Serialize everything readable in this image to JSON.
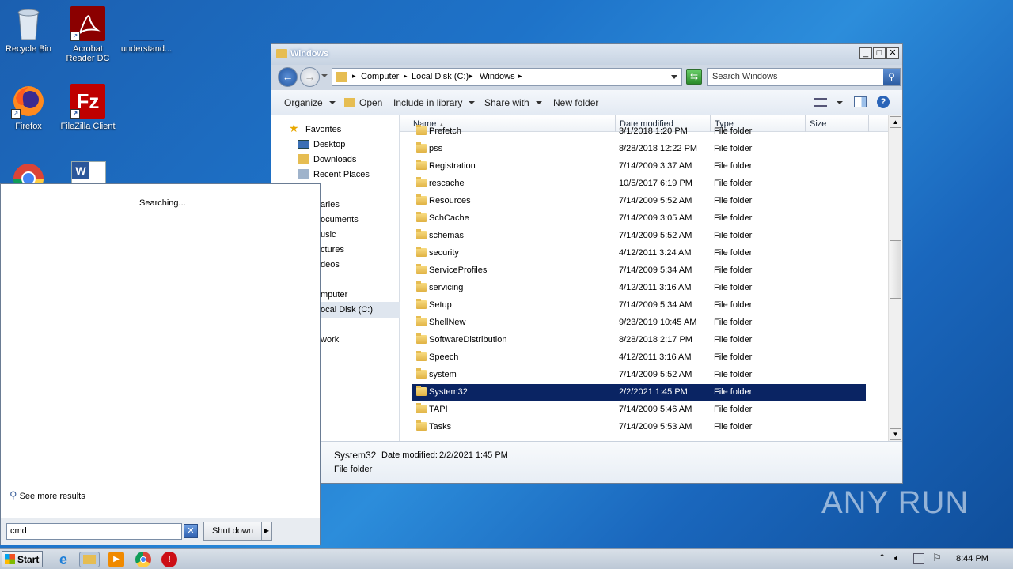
{
  "desktop": {
    "icons": [
      {
        "label": "Recycle Bin"
      },
      {
        "label": "Acrobat Reader DC"
      },
      {
        "label": "understand..."
      },
      {
        "label": "Firefox"
      },
      {
        "label": "FileZilla Client"
      }
    ]
  },
  "explorer": {
    "title": "Windows",
    "breadcrumb": [
      "Computer",
      "Local Disk (C:)",
      "Windows"
    ],
    "search_placeholder": "Search Windows",
    "toolbar": {
      "organize": "Organize",
      "open": "Open",
      "include": "Include in library",
      "share": "Share with",
      "new_folder": "New folder"
    },
    "nav": {
      "favorites": "Favorites",
      "desktop": "Desktop",
      "downloads": "Downloads",
      "recent": "Recent Places",
      "libraries": "aries",
      "documents": "ocuments",
      "music": "usic",
      "pictures": "ctures",
      "videos": "deos",
      "computer": "mputer",
      "local_disk": "ocal Disk (C:)",
      "network": "work"
    },
    "columns": {
      "name": "Name",
      "date": "Date modified",
      "type": "Type",
      "size": "Size"
    },
    "files": [
      {
        "name": "Prefetch",
        "date": "3/1/2018 1:20 PM",
        "type": "File folder"
      },
      {
        "name": "pss",
        "date": "8/28/2018 12:22 PM",
        "type": "File folder"
      },
      {
        "name": "Registration",
        "date": "7/14/2009 3:37 AM",
        "type": "File folder"
      },
      {
        "name": "rescache",
        "date": "10/5/2017 6:19 PM",
        "type": "File folder"
      },
      {
        "name": "Resources",
        "date": "7/14/2009 5:52 AM",
        "type": "File folder"
      },
      {
        "name": "SchCache",
        "date": "7/14/2009 3:05 AM",
        "type": "File folder"
      },
      {
        "name": "schemas",
        "date": "7/14/2009 5:52 AM",
        "type": "File folder"
      },
      {
        "name": "security",
        "date": "4/12/2011 3:24 AM",
        "type": "File folder"
      },
      {
        "name": "ServiceProfiles",
        "date": "7/14/2009 5:34 AM",
        "type": "File folder"
      },
      {
        "name": "servicing",
        "date": "4/12/2011 3:16 AM",
        "type": "File folder"
      },
      {
        "name": "Setup",
        "date": "7/14/2009 5:34 AM",
        "type": "File folder"
      },
      {
        "name": "ShellNew",
        "date": "9/23/2019 10:45 AM",
        "type": "File folder"
      },
      {
        "name": "SoftwareDistribution",
        "date": "8/28/2018 2:17 PM",
        "type": "File folder"
      },
      {
        "name": "Speech",
        "date": "4/12/2011 3:16 AM",
        "type": "File folder"
      },
      {
        "name": "system",
        "date": "7/14/2009 5:52 AM",
        "type": "File folder"
      },
      {
        "name": "System32",
        "date": "2/2/2021 1:45 PM",
        "type": "File folder",
        "selected": true
      },
      {
        "name": "TAPI",
        "date": "7/14/2009 5:46 AM",
        "type": "File folder"
      },
      {
        "name": "Tasks",
        "date": "7/14/2009 5:53 AM",
        "type": "File folder"
      }
    ],
    "details": {
      "name": "System32",
      "date_label": "Date modified:",
      "date": "2/2/2021 1:45 PM",
      "type": "File folder"
    }
  },
  "startmenu": {
    "status": "Searching...",
    "see_more": "See more results",
    "search_value": "cmd",
    "shutdown": "Shut down"
  },
  "taskbar": {
    "start": "Start",
    "clock": "8:44 PM"
  },
  "watermark": "ANY RUN",
  "colors": {
    "selection": "#0a2463",
    "desktop": "#1e73c9"
  }
}
